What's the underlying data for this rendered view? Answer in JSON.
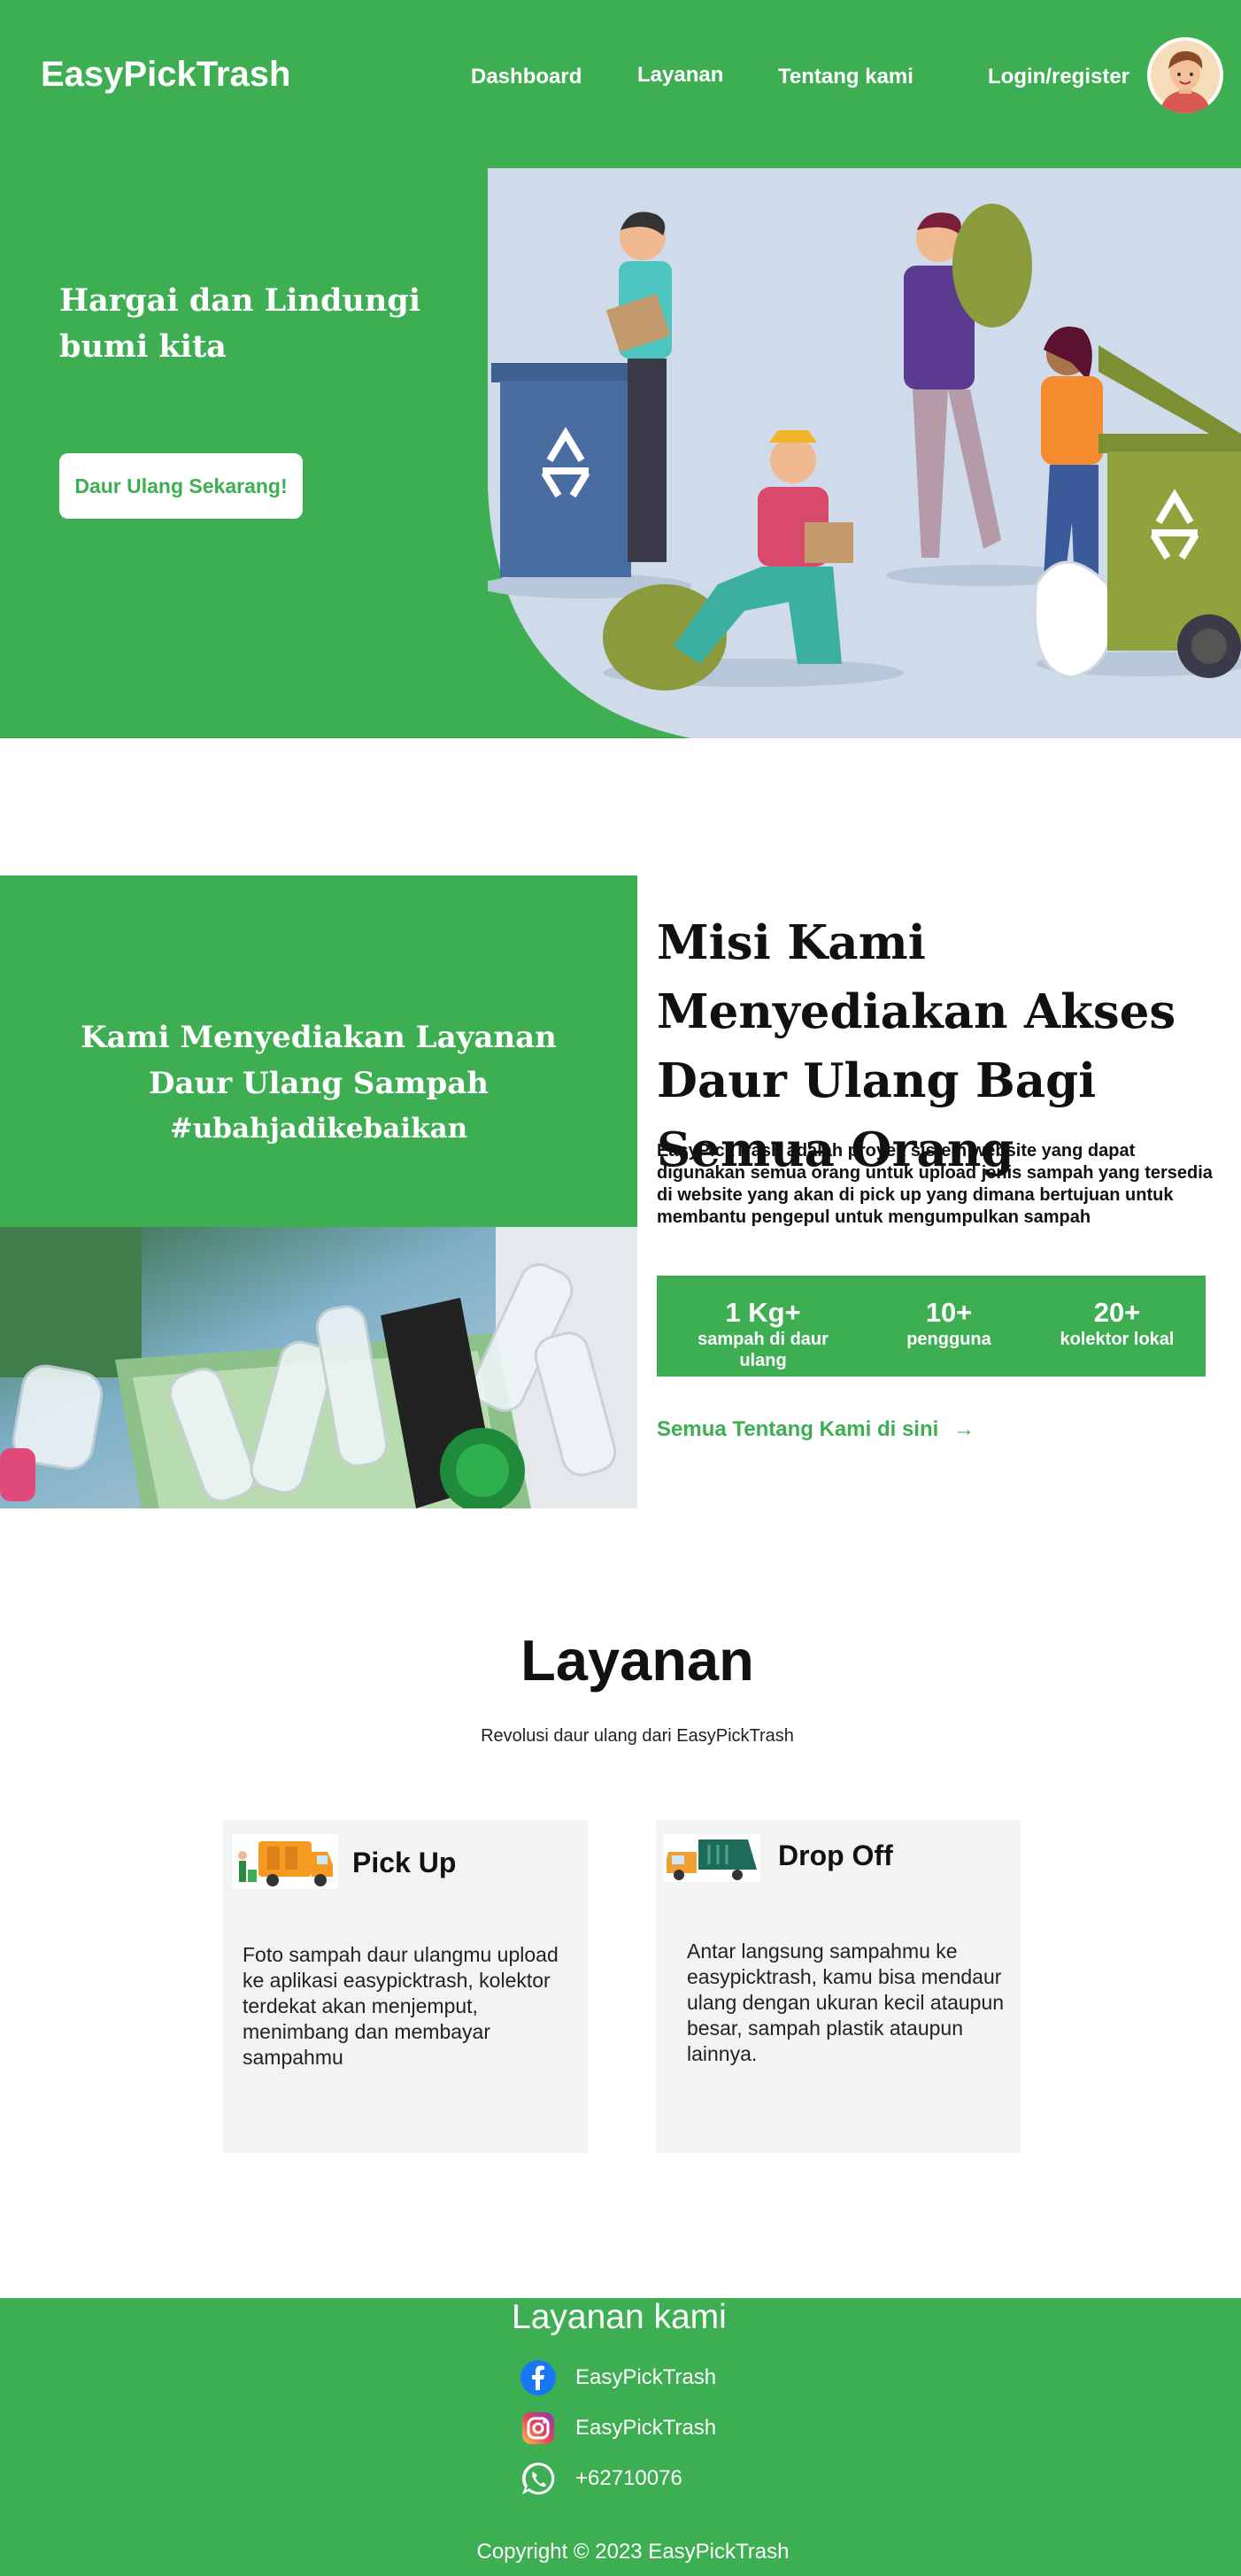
{
  "nav": {
    "brand": "EasyPickTrash",
    "links": [
      "Dashboard",
      "Layanan",
      "Tentang kami"
    ],
    "login": "Login/register"
  },
  "hero": {
    "title": "Hargai dan Lindungi bumi kita",
    "cta": "Daur Ulang Sekarang!"
  },
  "mission": {
    "box_line1": "Kami Menyediakan Layanan",
    "box_line2": "Daur Ulang Sampah",
    "box_tag": "#ubahjadikebaikan",
    "title": "Misi Kami Menyediakan Akses Daur Ulang Bagi Semua Orang",
    "description": "EasyPickTrash adalah proyek sistem website yang dapat digunakan semua orang untuk upload jenis sampah yang tersedia di website yang akan di pick up yang dimana bertujuan untuk membantu pengepul untuk mengumpulkan sampah",
    "stats": [
      {
        "value": "1 Kg+",
        "label": "sampah di daur ulang"
      },
      {
        "value": "10+",
        "label": "pengguna"
      },
      {
        "value": "20+",
        "label": "kolektor lokal"
      }
    ],
    "about_link": "Semua Tentang Kami di sini",
    "about_arrow": "→"
  },
  "services": {
    "title": "Layanan",
    "subtitle": "Revolusi daur ulang dari EasyPickTrash",
    "cards": [
      {
        "title": "Pick Up",
        "icon": "pickup-truck-icon",
        "description": "Foto sampah daur ulangmu upload ke aplikasi easypicktrash, kolektor terdekat akan menjemput, menimbang dan membayar sampahmu"
      },
      {
        "title": "Drop Off",
        "icon": "garbage-truck-icon",
        "description": "Antar langsung sampahmu ke easypicktrash, kamu bisa mendaur ulang dengan ukuran kecil ataupun besar, sampah plastik ataupun lainnya."
      }
    ]
  },
  "footer": {
    "title": "Layanan kami",
    "items": [
      {
        "icon": "facebook-icon",
        "text": "EasyPickTrash"
      },
      {
        "icon": "instagram-icon",
        "text": "EasyPickTrash"
      },
      {
        "icon": "whatsapp-icon",
        "text": "+62710076"
      }
    ],
    "copyright": "Copyright ©  2023 EasyPickTrash"
  },
  "colors": {
    "brand_green": "#3dae52",
    "illustration_bg": "#cfdaea"
  }
}
